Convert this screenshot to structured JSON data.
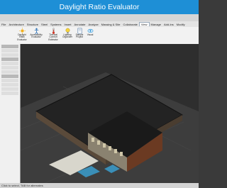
{
  "app": {
    "title": "Daylight Ratio Evaluator"
  },
  "ribbon": {
    "tabs": [
      "File",
      "Architecture",
      "Structure",
      "Steel",
      "Systems",
      "Insert",
      "Annotate",
      "Analyze",
      "Massing & Site",
      "Collaborate",
      "View",
      "Manage",
      "Add-Ins",
      "Modify"
    ],
    "active_tab": "View",
    "buttons": [
      {
        "label": "Daylight Ratio Evaluator",
        "icon": "sun-icon"
      },
      {
        "label": "Accessibility Evaluator",
        "icon": "accessibility-icon"
      },
      {
        "label": "Thermal Comfort Estimator",
        "icon": "thermometer-icon"
      },
      {
        "label": "Lighting Organizer",
        "icon": "bulb-icon"
      },
      {
        "label": "Sample Project",
        "icon": "document-icon"
      },
      {
        "label": "Visual",
        "icon": "eye-icon"
      }
    ]
  },
  "status": {
    "text": "Click to select, TAB for alternates"
  },
  "colors": {
    "accent": "#1e8fd6",
    "viewport": "#2e2e2e"
  }
}
